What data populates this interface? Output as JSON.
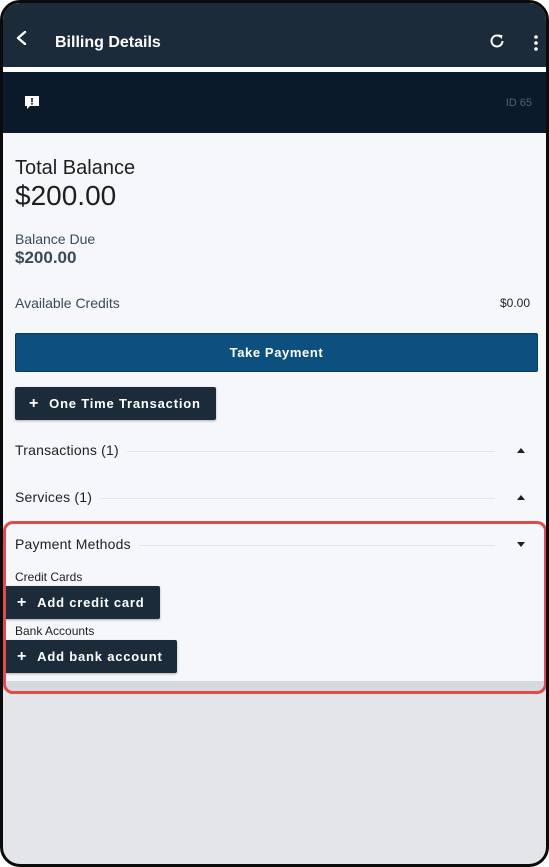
{
  "header": {
    "title": "Billing Details",
    "back_icon": "chevron-left-icon",
    "refresh_icon": "refresh-icon",
    "more_icon": "more-vert-icon"
  },
  "banner": {
    "icon": "feedback-icon",
    "id_text": "ID 65"
  },
  "balance": {
    "total_label": "Total Balance",
    "total_value": "$200.00",
    "due_label": "Balance Due",
    "due_value": "$200.00",
    "credits_label": "Available Credits",
    "credits_value": "$0.00"
  },
  "actions": {
    "take_payment": "Take Payment",
    "one_time": "One Time Transaction"
  },
  "sections": {
    "transactions": "Transactions (1)",
    "services": "Services (1)",
    "payment_methods": "Payment Methods"
  },
  "payment_methods": {
    "credit_cards_label": "Credit Cards",
    "add_credit_card": "Add credit card",
    "bank_accounts_label": "Bank Accounts",
    "add_bank_account": "Add bank account"
  },
  "colors": {
    "appbar": "#1c2b3a",
    "primary": "#0d4f7e",
    "highlight": "#e04b4b"
  }
}
